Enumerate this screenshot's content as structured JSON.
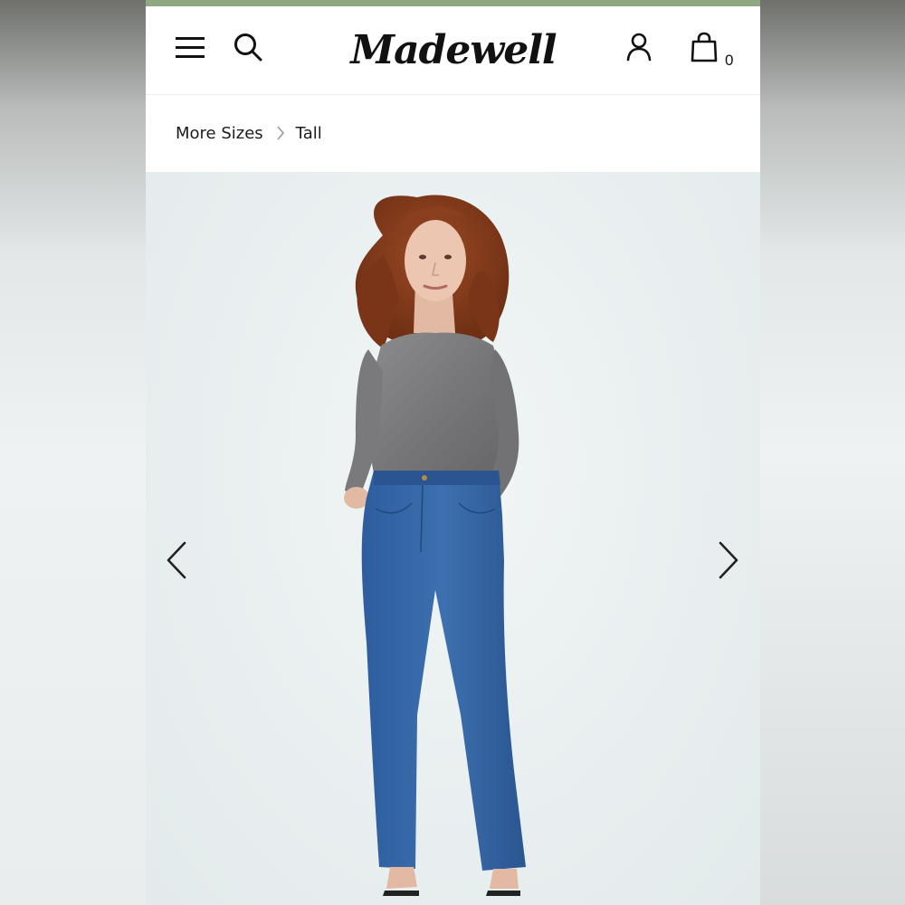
{
  "header": {
    "brand": "Madewell",
    "bag_count": "0",
    "icons": {
      "menu": "hamburger-menu-icon",
      "search": "search-icon",
      "account": "account-icon",
      "bag": "shopping-bag-icon"
    }
  },
  "breadcrumb": {
    "items": [
      "More Sizes",
      "Tall"
    ]
  },
  "carousel": {
    "prev_icon": "chevron-left-icon",
    "next_icon": "chevron-right-icon",
    "image_subject": "model-photo"
  },
  "colors": {
    "top_strip": "#8fa882",
    "text": "#111111",
    "hero_bg": "#e9eff0"
  }
}
